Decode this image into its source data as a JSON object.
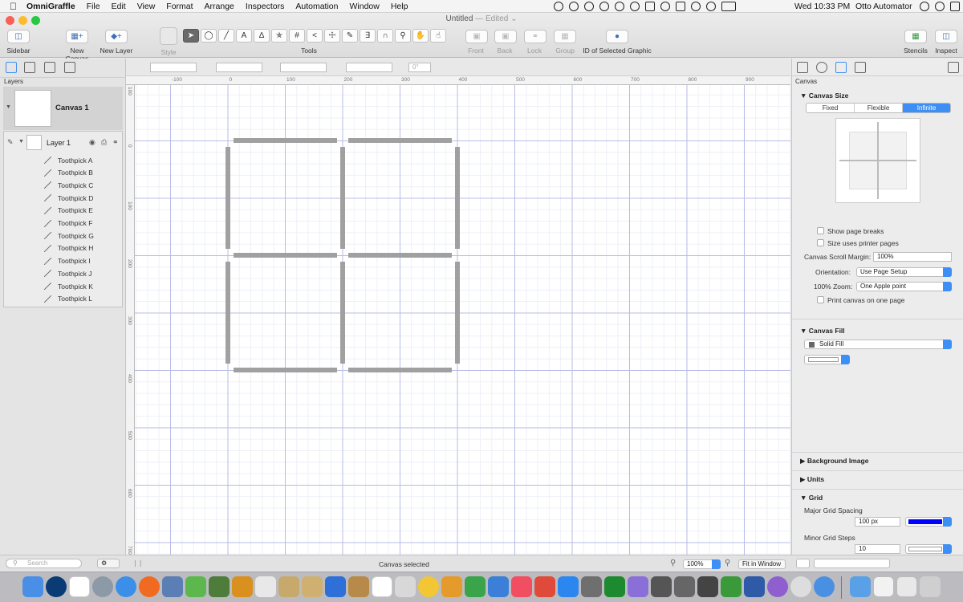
{
  "menubar": {
    "apple": "",
    "items": [
      "OmniGraffle",
      "File",
      "Edit",
      "View",
      "Format",
      "Arrange",
      "Inspectors",
      "Automation",
      "Window",
      "Help"
    ],
    "clock": "Wed 10:33 PM",
    "user": "Otto Automator"
  },
  "window": {
    "title": "Untitled",
    "edited": "— Edited ⌄"
  },
  "toolbar": {
    "sidebar": "Sidebar",
    "new_canvas": "New Canvas",
    "new_layer": "New Layer",
    "style": "Style",
    "tools": "Tools",
    "front": "Front",
    "back": "Back",
    "lock": "Lock",
    "group": "Group",
    "id_selected": "ID of Selected Graphic",
    "stencils": "Stencils",
    "inspect": "Inspect",
    "rotation": "0°"
  },
  "left_panel": {
    "header": "Layers",
    "canvas_name": "Canvas 1",
    "layer_name": "Layer 1",
    "layer_items": [
      "Toothpick A",
      "Toothpick B",
      "Toothpick C",
      "Toothpick D",
      "Toothpick E",
      "Toothpick F",
      "Toothpick G",
      "Toothpick H",
      "Toothpick I",
      "Toothpick J",
      "Toothpick K",
      "Toothpick L"
    ]
  },
  "rulers": {
    "h": [
      "-100",
      "0",
      "100",
      "200",
      "300",
      "400",
      "500",
      "600",
      "700",
      "800",
      "900"
    ],
    "v": [
      "100",
      "0",
      "100",
      "200",
      "300",
      "400",
      "500",
      "600",
      "700"
    ]
  },
  "right_panel": {
    "header": "Canvas",
    "canvas_size": {
      "title": "Canvas Size",
      "modes": [
        "Fixed",
        "Flexible",
        "Infinite"
      ],
      "selected": "Infinite",
      "show_page_breaks": "Show page breaks",
      "size_uses_printer": "Size uses printer pages",
      "scroll_margin_label": "Canvas Scroll Margin:",
      "scroll_margin_value": "100%",
      "orientation_label": "Orientation:",
      "orientation_value": "Use Page Setup",
      "zoom_label": "100% Zoom:",
      "zoom_value": "One Apple point",
      "print_one_page": "Print canvas on one page"
    },
    "canvas_fill": {
      "title": "Canvas Fill",
      "fill_type": "Solid Fill"
    },
    "background_image": "Background Image",
    "units": "Units",
    "grid": {
      "title": "Grid",
      "major_label": "Major Grid Spacing",
      "major_value": "100 px",
      "major_color": "#0000ff",
      "minor_label": "Minor Grid Steps",
      "minor_value": "10"
    }
  },
  "statusbar": {
    "search_placeholder": "Search",
    "status_text": "Canvas selected",
    "zoom_value": "100%",
    "fit_button": "Fit in Window"
  },
  "colors": {
    "accent": "#3d8ff5",
    "toothpick": "#a0a0a0",
    "grid_major": "#b8bce8"
  }
}
